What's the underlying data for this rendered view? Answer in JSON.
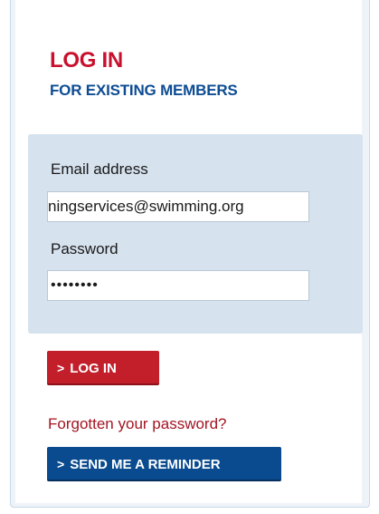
{
  "header": {
    "title": "LOG IN",
    "subtitle": "FOR EXISTING MEMBERS"
  },
  "form": {
    "email_label": "Email address",
    "email_value": "ningservices@swimming.org",
    "password_label": "Password",
    "password_value": "••••••••"
  },
  "buttons": {
    "login_chevron": ">",
    "login_label": "LOG IN",
    "forgot_text": "Forgotten your password?",
    "remind_chevron": ">",
    "remind_label": "SEND ME A REMINDER"
  },
  "colors": {
    "brand_red": "#c8102e",
    "brand_blue": "#0d4c93",
    "form_bg": "#d6e2ee"
  }
}
